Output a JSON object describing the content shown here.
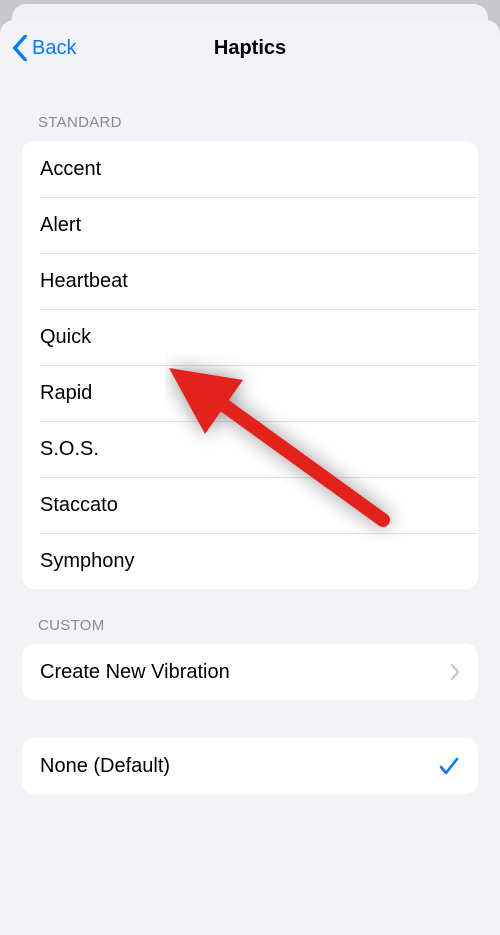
{
  "nav": {
    "back_label": "Back",
    "title": "Haptics"
  },
  "sections": {
    "standard": {
      "header": "Standard",
      "items": [
        {
          "label": "Accent"
        },
        {
          "label": "Alert"
        },
        {
          "label": "Heartbeat"
        },
        {
          "label": "Quick"
        },
        {
          "label": "Rapid"
        },
        {
          "label": "S.O.S."
        },
        {
          "label": "Staccato"
        },
        {
          "label": "Symphony"
        }
      ]
    },
    "custom": {
      "header": "Custom",
      "create_label": "Create New Vibration"
    },
    "none": {
      "label": "None (Default)"
    }
  }
}
